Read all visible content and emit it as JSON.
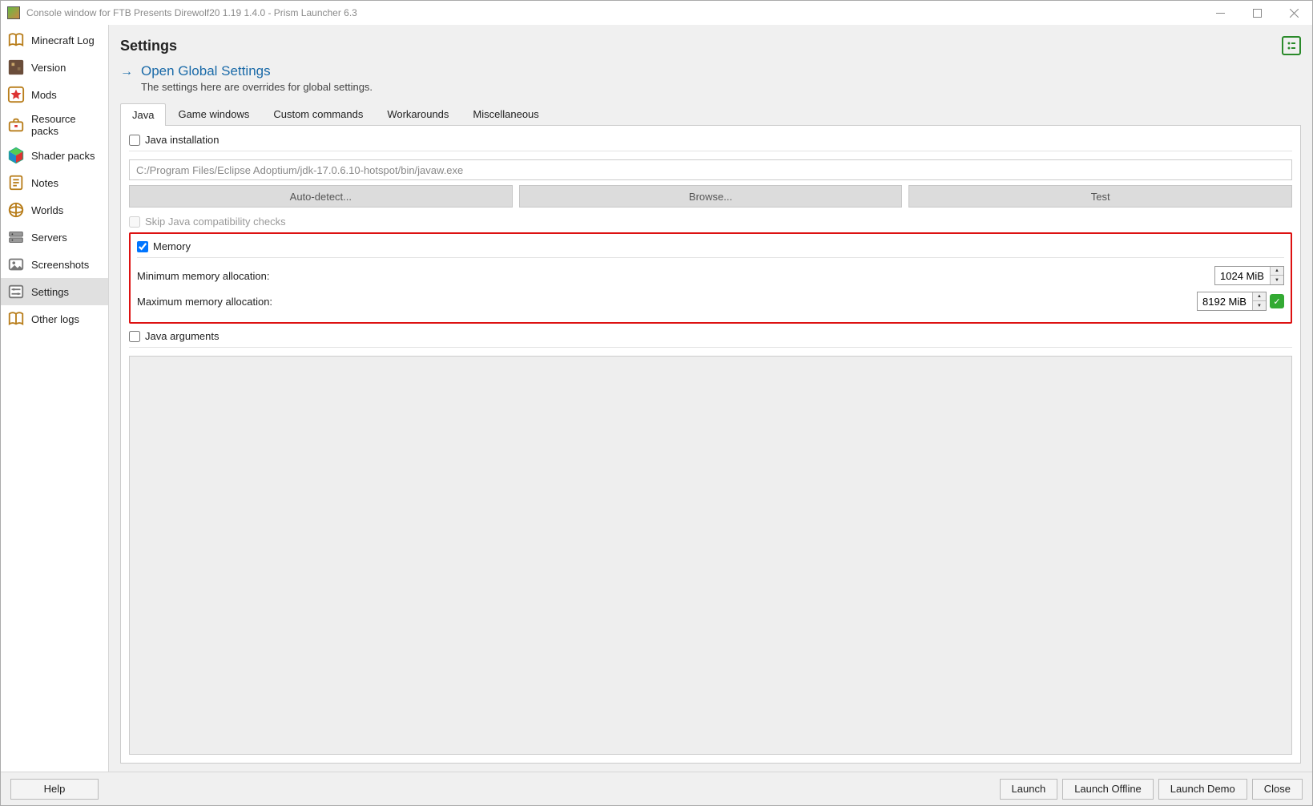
{
  "window": {
    "title": "Console window for FTB Presents Direwolf20 1.19 1.4.0 - Prism Launcher 6.3"
  },
  "sidebar": {
    "items": [
      {
        "label": "Minecraft Log"
      },
      {
        "label": "Version"
      },
      {
        "label": "Mods"
      },
      {
        "label": "Resource packs"
      },
      {
        "label": "Shader packs"
      },
      {
        "label": "Notes"
      },
      {
        "label": "Worlds"
      },
      {
        "label": "Servers"
      },
      {
        "label": "Screenshots"
      },
      {
        "label": "Settings"
      },
      {
        "label": "Other logs"
      }
    ]
  },
  "content": {
    "title": "Settings",
    "global_link": "Open Global Settings",
    "global_sub": "The settings here are overrides for global settings.",
    "tabs": [
      {
        "label": "Java"
      },
      {
        "label": "Game windows"
      },
      {
        "label": "Custom commands"
      },
      {
        "label": "Workarounds"
      },
      {
        "label": "Miscellaneous"
      }
    ],
    "java": {
      "install_label": "Java installation",
      "install_checked": false,
      "path": "C:/Program Files/Eclipse Adoptium/jdk-17.0.6.10-hotspot/bin/javaw.exe",
      "auto_detect": "Auto-detect...",
      "browse": "Browse...",
      "test": "Test",
      "skip_compat": "Skip Java compatibility checks",
      "memory_label": "Memory",
      "memory_checked": true,
      "min_label": "Minimum memory allocation:",
      "min_value": "1024 MiB",
      "max_label": "Maximum memory allocation:",
      "max_value": "8192 MiB",
      "args_label": "Java arguments",
      "args_checked": false
    }
  },
  "bottom": {
    "help": "Help",
    "launch": "Launch",
    "launch_offline": "Launch Offline",
    "launch_demo": "Launch Demo",
    "close": "Close"
  }
}
